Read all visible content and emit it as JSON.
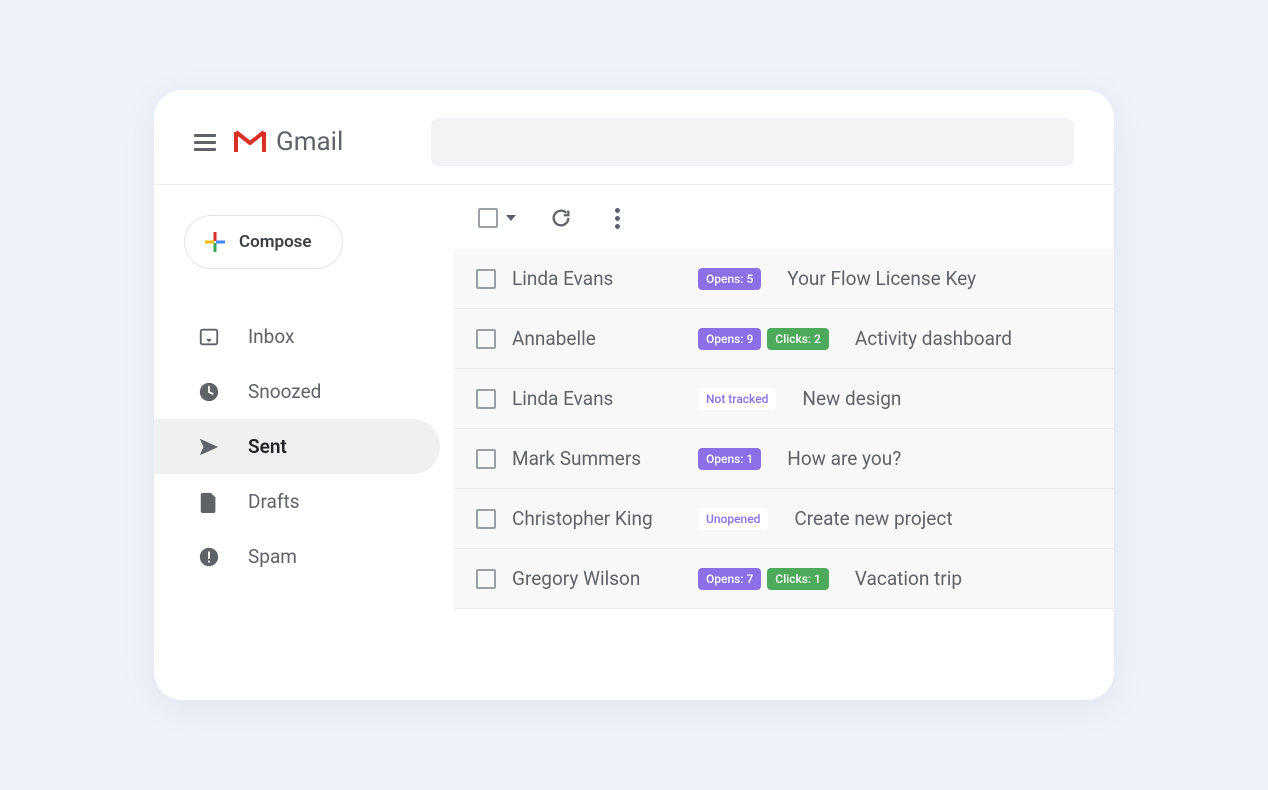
{
  "header": {
    "app_name": "Gmail"
  },
  "sidebar": {
    "compose_label": "Compose",
    "items": [
      {
        "key": "inbox",
        "label": "Inbox",
        "active": false
      },
      {
        "key": "snoozed",
        "label": "Snoozed",
        "active": false
      },
      {
        "key": "sent",
        "label": "Sent",
        "active": true
      },
      {
        "key": "drafts",
        "label": "Drafts",
        "active": false
      },
      {
        "key": "spam",
        "label": "Spam",
        "active": false
      }
    ]
  },
  "emails": [
    {
      "sender": "Linda Evans",
      "badges": [
        {
          "type": "opens",
          "text": "Opens: 5"
        }
      ],
      "subject": "Your Flow License Key"
    },
    {
      "sender": "Annabelle",
      "badges": [
        {
          "type": "opens",
          "text": "Opens: 9"
        },
        {
          "type": "clicks",
          "text": "Clicks: 2"
        }
      ],
      "subject": "Activity dashboard"
    },
    {
      "sender": "Linda Evans",
      "badges": [
        {
          "type": "nottracked",
          "text": "Not tracked"
        }
      ],
      "subject": "New design"
    },
    {
      "sender": "Mark Summers",
      "badges": [
        {
          "type": "opens",
          "text": "Opens: 1"
        }
      ],
      "subject": "How are you?"
    },
    {
      "sender": "Christopher King",
      "badges": [
        {
          "type": "unopened",
          "text": "Unopened"
        }
      ],
      "subject": "Create new project"
    },
    {
      "sender": "Gregory Wilson",
      "badges": [
        {
          "type": "opens",
          "text": "Opens: 7"
        },
        {
          "type": "clicks",
          "text": "Clicks: 1"
        }
      ],
      "subject": "Vacation trip"
    }
  ]
}
